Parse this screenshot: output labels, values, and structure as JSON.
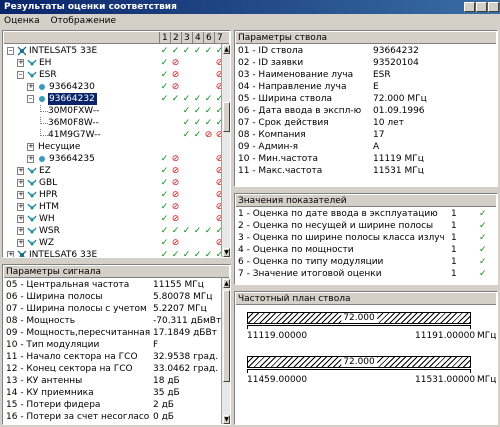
{
  "window": {
    "title": "Результаты оценки соответствия"
  },
  "menu": [
    "Оценка",
    "Отображение"
  ],
  "tree": {
    "columns": [
      "1",
      "2",
      "3",
      "4",
      "6",
      "7"
    ],
    "rows": [
      {
        "label": "INTELSAT5 33E",
        "marks": [
          "ok",
          "ok",
          "ok",
          "ok",
          "ok",
          "ok"
        ]
      },
      {
        "label": "EH",
        "marks": [
          "ok",
          "no",
          "",
          "",
          "",
          "no"
        ]
      },
      {
        "label": "ESR",
        "marks": [
          "ok",
          "no",
          "",
          "",
          "",
          "no"
        ]
      },
      {
        "label": "93664230",
        "marks": [
          "ok",
          "no",
          "",
          "",
          "",
          "no"
        ]
      },
      {
        "label": "93664232",
        "marks": [
          "ok",
          "ok",
          "ok",
          "ok",
          "ok",
          "ok"
        ]
      },
      {
        "label": "30M0FXW--",
        "marks": [
          "",
          "",
          "ok",
          "ok",
          "ok",
          "ok"
        ]
      },
      {
        "label": "36M0F8W--",
        "marks": [
          "",
          "",
          "ok",
          "ok",
          "ok",
          "ok"
        ]
      },
      {
        "label": "41M9G7W--",
        "marks": [
          "",
          "",
          "ok",
          "ok",
          "no",
          "no"
        ]
      },
      {
        "label": "Несущие",
        "marks": [
          "",
          "",
          "",
          "",
          "",
          ""
        ]
      },
      {
        "label": "93664235",
        "marks": [
          "ok",
          "no",
          "",
          "",
          "",
          "no"
        ]
      },
      {
        "label": "EZ",
        "marks": [
          "ok",
          "no",
          "",
          "",
          "",
          "no"
        ]
      },
      {
        "label": "GBL",
        "marks": [
          "ok",
          "no",
          "",
          "",
          "",
          "no"
        ]
      },
      {
        "label": "HPR",
        "marks": [
          "ok",
          "no",
          "",
          "",
          "",
          "no"
        ]
      },
      {
        "label": "HTM",
        "marks": [
          "ok",
          "no",
          "",
          "",
          "",
          "no"
        ]
      },
      {
        "label": "WH",
        "marks": [
          "ok",
          "no",
          "",
          "",
          "",
          "no"
        ]
      },
      {
        "label": "WSR",
        "marks": [
          "ok",
          "ok",
          "ok",
          "ok",
          "ok",
          "ok"
        ]
      },
      {
        "label": "WZ",
        "marks": [
          "ok",
          "no",
          "",
          "",
          "",
          "no"
        ]
      },
      {
        "label": "INTELSAT6 33E",
        "marks": [
          "ok",
          "ok",
          "ok",
          "ok",
          "ok",
          "ok"
        ]
      }
    ]
  },
  "signal": {
    "header": "Параметры сигнала",
    "rows": [
      [
        "05 - Центральная частота",
        "11155 МГц"
      ],
      [
        "06 - Ширина полосы",
        "5.80078 МГц"
      ],
      [
        "07 - Ширина полосы с учетом погр...",
        "5.2207 МГц"
      ],
      [
        "08 - Мощность",
        "-70.311 дБмВт"
      ],
      [
        "09 - Мощность,пересчитанная ко в...",
        "17.1849 дБВт"
      ],
      [
        "10 - Тип модуляции",
        "F"
      ],
      [
        "11 - Начало сектора на ГСО",
        "32.9538 град."
      ],
      [
        "12 - Конец сектора на ГСО",
        "33.0462 град."
      ],
      [
        "13 - КУ антенны",
        "18 дБ"
      ],
      [
        "14 - КУ приемника",
        "35 дБ"
      ],
      [
        "15 - Потери фидера",
        "2 дБ"
      ],
      [
        "16 - Потери за счет несогласования",
        "0 дБ"
      ]
    ]
  },
  "channel": {
    "header": "Параметры ствола",
    "rows": [
      [
        "01 - ID ствола",
        "93664232"
      ],
      [
        "02 - ID заявки",
        "93520104"
      ],
      [
        "03 - Наименование луча",
        "ESR"
      ],
      [
        "04 - Направление луча",
        "E"
      ],
      [
        "05 - Ширина ствола",
        "72.000 МГц"
      ],
      [
        "06 - Дата ввода в экспл-ю",
        "01.09.1996"
      ],
      [
        "07 - Срок действия",
        "10 лет"
      ],
      [
        "08 - Компания",
        "17"
      ],
      [
        "09 - Админ-я",
        "A"
      ],
      [
        "10 - Мин.частота",
        "11119 МГц"
      ],
      [
        "11 - Макс.частота",
        "11531 МГц"
      ]
    ]
  },
  "indicators": {
    "header": "Значения показателей",
    "rows": [
      {
        "label": "1 - Оценка по дате ввода в эксплуатацию",
        "value": "1",
        "mark": "ok"
      },
      {
        "label": "2 - Оценка по несущей и ширине полосы",
        "value": "1",
        "mark": "ok"
      },
      {
        "label": "3 - Оценка по ширине полосы класса излучения",
        "value": "1",
        "mark": "ok"
      },
      {
        "label": "4 - Оценка по мощности",
        "value": "1",
        "mark": "ok"
      },
      {
        "label": "6 - Оценка по типу модуляции",
        "value": "1",
        "mark": "ok"
      },
      {
        "label": "7 - Значение итоговой оценки",
        "value": "1",
        "mark": "ok"
      }
    ]
  },
  "freqplan": {
    "header": "Частотный план ствола",
    "bands": [
      {
        "width_label": "72.000",
        "min": "11119.00000",
        "max": "11191.00000",
        "unit": "МГц"
      },
      {
        "width_label": "72.000",
        "min": "11459.00000",
        "max": "11531.00000",
        "unit": "МГц"
      }
    ]
  },
  "colors": {
    "ok": "#0a8a0a",
    "no": "#d01010",
    "selection": "#0a246a",
    "title": "#0a246a"
  }
}
